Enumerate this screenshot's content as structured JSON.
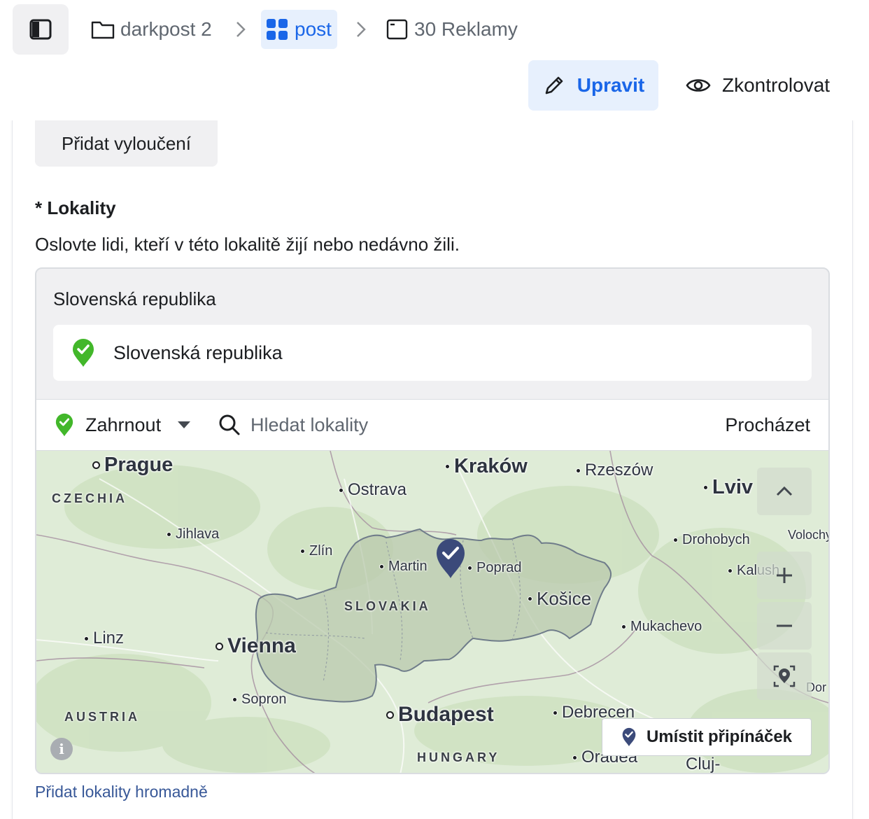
{
  "breadcrumb": {
    "items": [
      {
        "label": "darkpost 2",
        "icon": "folder-icon"
      },
      {
        "label": "post",
        "icon": "grid-icon"
      },
      {
        "label": "30 Reklamy",
        "icon": "window-icon"
      }
    ]
  },
  "toolbar": {
    "edit_label": "Upravit",
    "review_label": "Zkontrolovat"
  },
  "exclusion": {
    "button_label": "Přidat vyloučení"
  },
  "locations": {
    "title": "* Lokality",
    "description": "Oslovte lidi, kteří v této lokalitě žijí nebo nedávno žili.",
    "selected_heading": "Slovenská republika",
    "selected_item": "Slovenská republika",
    "include_mode": "Zahrnout",
    "search_placeholder": "Hledat lokality",
    "browse_label": "Procházet",
    "bulk_link": "Přidat lokality hromadně"
  },
  "map": {
    "cities": [
      "Prague",
      "Kraków",
      "Rzeszów",
      "Lviv",
      "Ostrava",
      "Jihlava",
      "Zlín",
      "Martin",
      "Poprad",
      "Drohobych",
      "Volochy",
      "Kalush",
      "Košice",
      "Mukachevo",
      "Linz",
      "Vienna",
      "Sopron",
      "Budapest",
      "Debrecen",
      "Oradea",
      "Cluj-",
      "Dor"
    ],
    "regions": [
      "CZECHIA",
      "SLOVAKIA",
      "AUSTRIA",
      "HUNGARY"
    ],
    "place_pin_label": "Umístit připínáček",
    "info_label": "i",
    "colors": {
      "land": "#dfecd7",
      "selected_area": "#b9c9ae",
      "pin": "#3b4a7a",
      "include_green": "#42b72a"
    }
  }
}
